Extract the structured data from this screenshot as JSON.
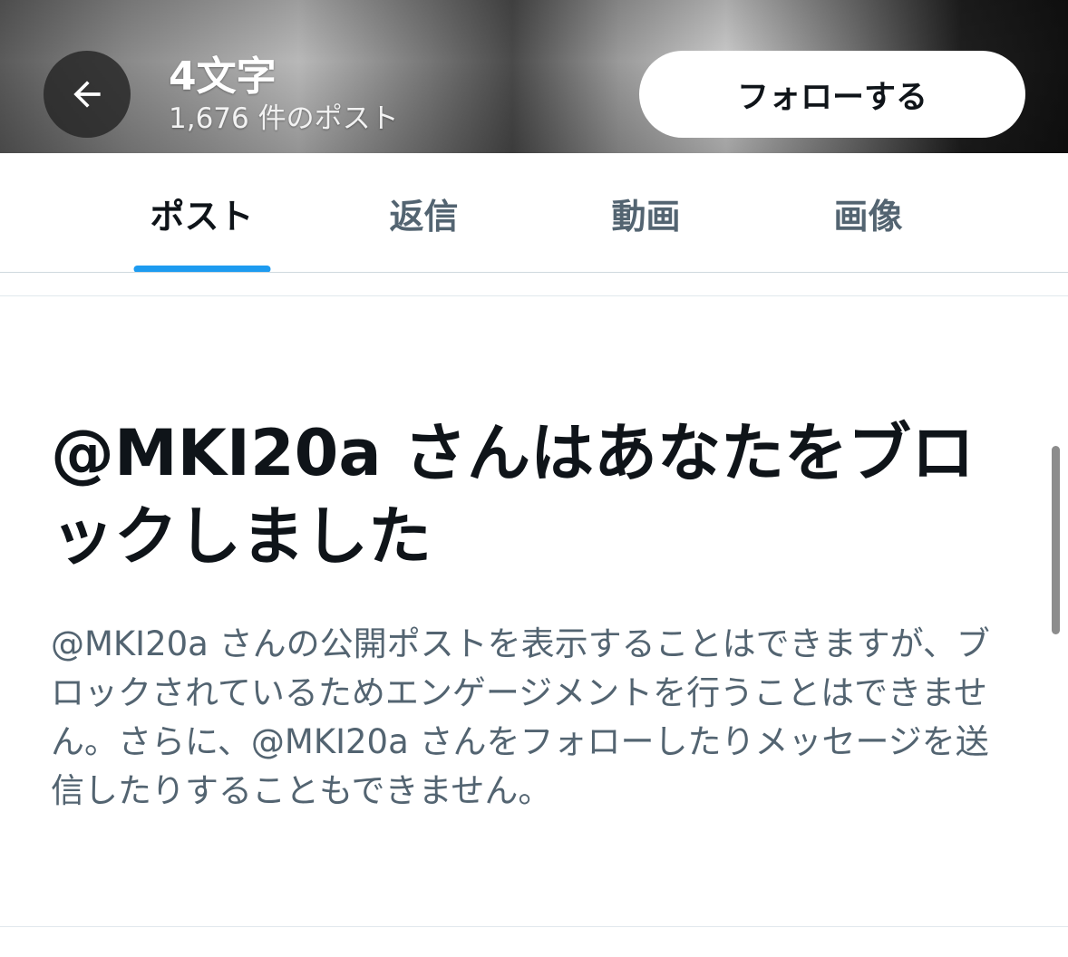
{
  "header": {
    "title": "4文字",
    "post_count": "1,676 件のポスト",
    "follow_label": "フォローする"
  },
  "tabs": [
    {
      "label": "ポスト",
      "active": true
    },
    {
      "label": "返信",
      "active": false
    },
    {
      "label": "動画",
      "active": false
    },
    {
      "label": "画像",
      "active": false
    }
  ],
  "blocked": {
    "title": "@MKI20a さんはあなたをブロックしました",
    "body": "@MKI20a さんの公開ポストを表示することはできますが、ブロックされているためエンゲージメントを行うことはできません。さらに、@MKI20a さんをフォローしたりメッセージを送信したりすることもできません。"
  },
  "colors": {
    "accent": "#1d9bf0",
    "text_primary": "#0f1419",
    "text_secondary": "#536471"
  },
  "icons": {
    "back": "arrow-left-icon"
  }
}
